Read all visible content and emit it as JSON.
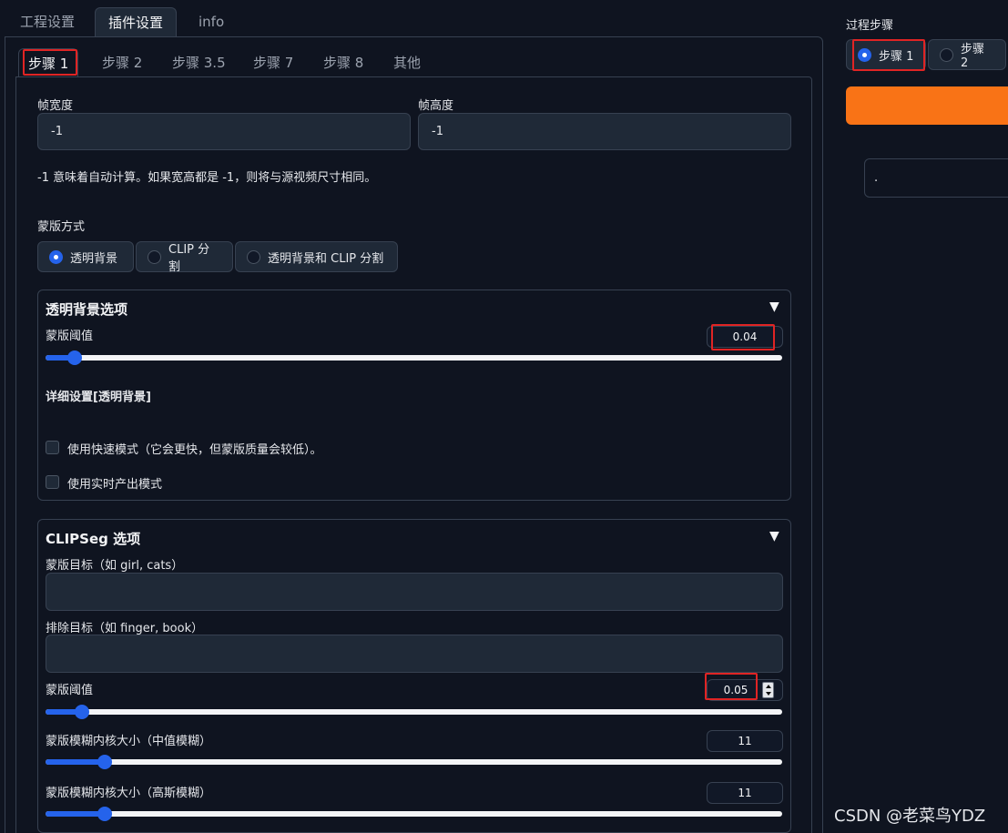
{
  "top_tabs": [
    "工程设置",
    "插件设置",
    "info"
  ],
  "sub_tabs": [
    "步骤 1",
    "步骤 2",
    "步骤 3.5",
    "步骤 7",
    "步骤 8",
    "其他"
  ],
  "frame": {
    "width_label": "帧宽度",
    "width_value": "-1",
    "height_label": "帧高度",
    "height_value": "-1",
    "hint": "-1 意味着自动计算。如果宽高都是 -1，则将与源视频尺寸相同。"
  },
  "mask_mode": {
    "label": "蒙版方式",
    "options": [
      "透明背景",
      "CLIP 分割",
      "透明背景和 CLIP 分割"
    ],
    "selected": "透明背景"
  },
  "transparent_bg": {
    "title": "透明背景选项",
    "threshold_label": "蒙版阈值",
    "threshold_value": "0.04",
    "threshold_fraction": 0.04,
    "detail_title": "详细设置[透明背景]",
    "checkbox_fast": "使用快速模式（它会更快，但蒙版质量会较低）。",
    "checkbox_realtime": "使用实时产出模式"
  },
  "clipseg": {
    "title": "CLIPSeg 选项",
    "target_label": "蒙版目标（如 girl, cats）",
    "target_value": "",
    "exclude_label": "排除目标（如 finger, book）",
    "exclude_value": "",
    "threshold_label": "蒙版阈值",
    "threshold_value": "0.05",
    "threshold_fraction": 0.05,
    "median_label": "蒙版模糊内核大小（中值模糊）",
    "median_value": "11",
    "gaussian_label": "蒙版模糊内核大小（高斯模糊）",
    "gaussian_value": "11"
  },
  "right_panel": {
    "label": "过程步骤",
    "options": [
      "步骤 1",
      "步骤 2"
    ],
    "selected": "步骤 1",
    "output_text": "."
  },
  "watermark": "CSDN @老菜鸟YDZ",
  "colors": {
    "accent": "#2563eb",
    "orange": "#f97316",
    "highlight": "#e02424"
  }
}
